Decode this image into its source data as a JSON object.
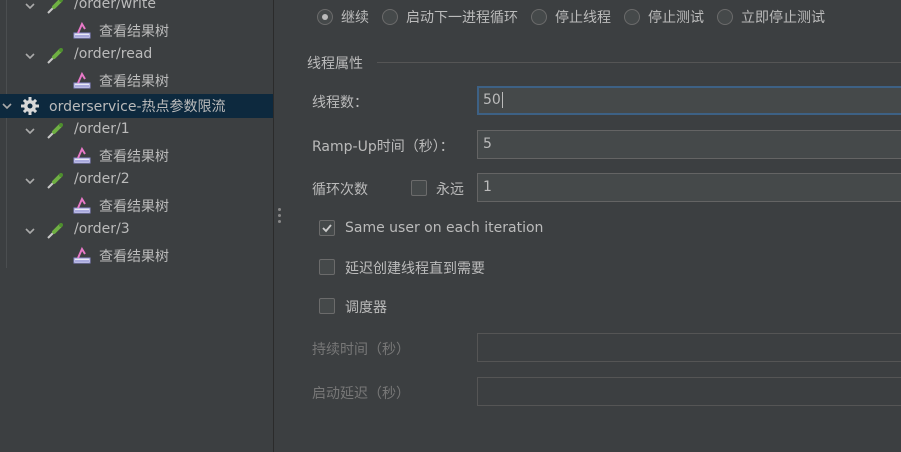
{
  "tree": {
    "rows": [
      {
        "label": "/order/write",
        "type": "sampler",
        "expanded": true
      },
      {
        "label": "查看结果树",
        "type": "listener"
      },
      {
        "label": "/order/read",
        "type": "sampler",
        "expanded": true
      },
      {
        "label": "查看结果树",
        "type": "listener"
      },
      {
        "label": "orderservice-热点参数限流",
        "type": "thread-group",
        "expanded": true,
        "selected": true
      },
      {
        "label": "/order/1",
        "type": "sampler",
        "expanded": true
      },
      {
        "label": "查看结果树",
        "type": "listener"
      },
      {
        "label": "/order/2",
        "type": "sampler",
        "expanded": true
      },
      {
        "label": "查看结果树",
        "type": "listener"
      },
      {
        "label": "/order/3",
        "type": "sampler",
        "expanded": true
      },
      {
        "label": "查看结果树",
        "type": "listener"
      }
    ]
  },
  "error_action": {
    "options": [
      "继续",
      "启动下一进程循环",
      "停止线程",
      "停止测试",
      "立即停止测试"
    ],
    "selected": "继续"
  },
  "thread_props": {
    "title": "线程属性",
    "num_threads_label": "线程数：",
    "num_threads_value": "50",
    "ramp_up_label": "Ramp-Up时间（秒）：",
    "ramp_up_value": "5",
    "loop_label": "循环次数",
    "forever_label": "永远",
    "forever_checked": false,
    "loop_value": "1",
    "same_user_label": "Same user on each iteration",
    "same_user_checked": true,
    "delay_create_label": "延迟创建线程直到需要",
    "delay_create_checked": false,
    "scheduler_label": "调度器",
    "scheduler_checked": false,
    "duration_label": "持续时间（秒）",
    "duration_value": "",
    "startup_delay_label": "启动延迟（秒）",
    "startup_delay_value": ""
  },
  "colors": {
    "background": "#3c3f41",
    "selection": "#0d293e",
    "text": "#bbbbbb",
    "field_bg": "#45494a",
    "focus_border": "#3d6185"
  }
}
